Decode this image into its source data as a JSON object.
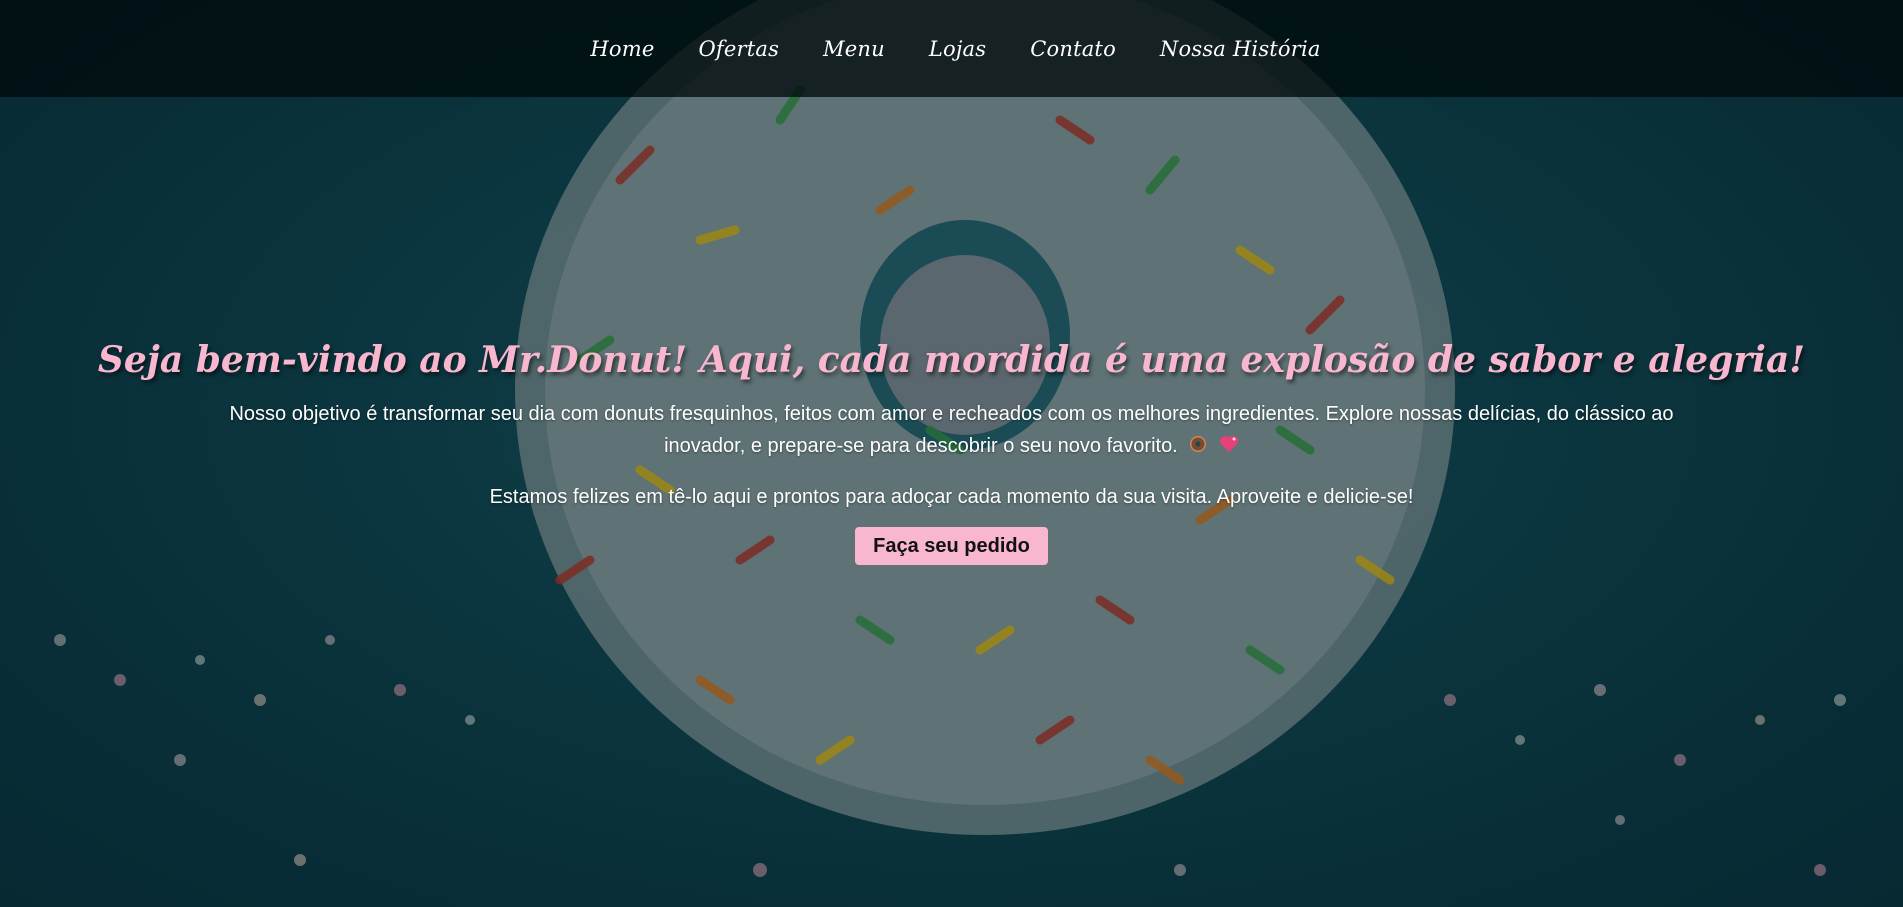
{
  "nav": {
    "items": [
      {
        "label": "Home"
      },
      {
        "label": "Ofertas"
      },
      {
        "label": "Menu"
      },
      {
        "label": "Lojas"
      },
      {
        "label": "Contato"
      },
      {
        "label": "Nossa História"
      }
    ]
  },
  "hero": {
    "headline": "Seja bem-vindo ao Mr.Donut! Aqui, cada mordida é uma explosão de sabor e alegria!",
    "paragraph_1": "Nosso objetivo é transformar seu dia com donuts fresquinhos, feitos com amor e recheados com os melhores ingredientes. Explore nossas delícias, do clássico ao inovador, e prepare-se para descobrir o seu novo favorito.",
    "emoji_icons": [
      "donut-icon",
      "sparkling-heart-icon"
    ],
    "paragraph_2": "Estamos felizes em tê-lo aqui e prontos para adoçar cada momento da sua visita. Aproveite e delicie-se!",
    "button_label": "Faça seu pedido"
  },
  "colors": {
    "accent_pink": "#f8b7cf",
    "background_teal": "#134a55",
    "navbar_bg": "#000a0c"
  }
}
